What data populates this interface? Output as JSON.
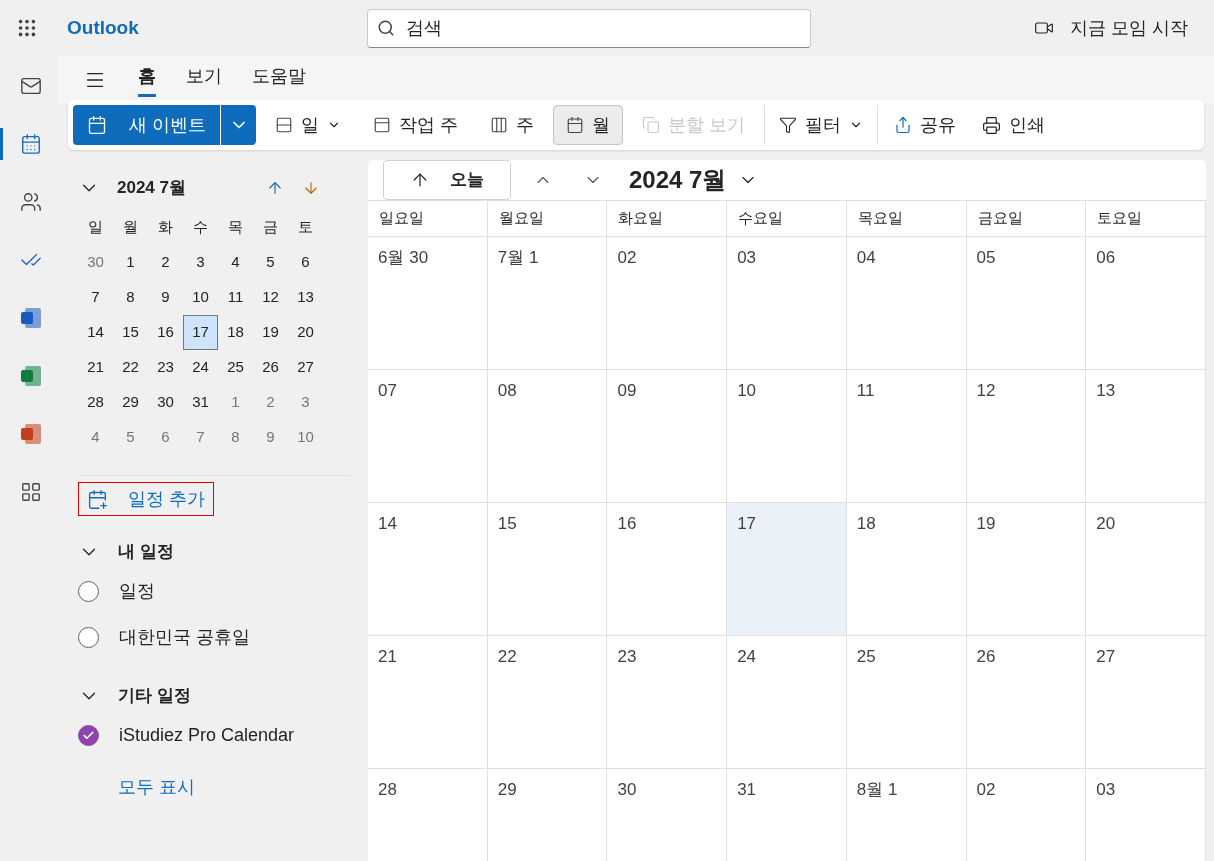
{
  "top_bar": {
    "brand": "Outlook",
    "search": {
      "placeholder": "검색"
    },
    "meet_now": "지금 모임 시작"
  },
  "rail": [
    {
      "kind": "mail",
      "selected": false
    },
    {
      "kind": "calendar",
      "selected": true
    },
    {
      "kind": "people",
      "selected": false
    },
    {
      "kind": "todo",
      "selected": false
    },
    {
      "kind": "word",
      "selected": false
    },
    {
      "kind": "excel",
      "selected": false
    },
    {
      "kind": "powerpoint",
      "selected": false
    },
    {
      "kind": "apps",
      "selected": false
    }
  ],
  "tabs": [
    {
      "label": "홈",
      "selected": true
    },
    {
      "label": "보기",
      "selected": false
    },
    {
      "label": "도움말",
      "selected": false
    }
  ],
  "toolbar": {
    "new_event": "새 이벤트",
    "views": [
      {
        "kind": "day",
        "label": "일",
        "selected": false,
        "disabled": false,
        "dropdown": true
      },
      {
        "kind": "workweek",
        "label": "작업 주",
        "selected": false,
        "disabled": false,
        "dropdown": false
      },
      {
        "kind": "week",
        "label": "주",
        "selected": false,
        "disabled": false,
        "dropdown": false
      },
      {
        "kind": "month",
        "label": "월",
        "selected": true,
        "disabled": false,
        "dropdown": false
      },
      {
        "kind": "split",
        "label": "분할 보기",
        "selected": false,
        "disabled": true,
        "dropdown": false
      }
    ],
    "filter": "필터",
    "share": "공유",
    "print": "인쇄"
  },
  "mini_calendar": {
    "title": "2024 7월",
    "weekdays": [
      "일",
      "월",
      "화",
      "수",
      "목",
      "금",
      "토"
    ],
    "weeks": [
      [
        {
          "day": "30",
          "outside": true,
          "selected": false
        },
        {
          "day": "1",
          "outside": false,
          "selected": false
        },
        {
          "day": "2",
          "outside": false,
          "selected": false
        },
        {
          "day": "3",
          "outside": false,
          "selected": false
        },
        {
          "day": "4",
          "outside": false,
          "selected": false
        },
        {
          "day": "5",
          "outside": false,
          "selected": false
        },
        {
          "day": "6",
          "outside": false,
          "selected": false
        }
      ],
      [
        {
          "day": "7",
          "outside": false,
          "selected": false
        },
        {
          "day": "8",
          "outside": false,
          "selected": false
        },
        {
          "day": "9",
          "outside": false,
          "selected": false
        },
        {
          "day": "10",
          "outside": false,
          "selected": false
        },
        {
          "day": "11",
          "outside": false,
          "selected": false
        },
        {
          "day": "12",
          "outside": false,
          "selected": false
        },
        {
          "day": "13",
          "outside": false,
          "selected": false
        }
      ],
      [
        {
          "day": "14",
          "outside": false,
          "selected": false
        },
        {
          "day": "15",
          "outside": false,
          "selected": false
        },
        {
          "day": "16",
          "outside": false,
          "selected": false
        },
        {
          "day": "17",
          "outside": false,
          "selected": true
        },
        {
          "day": "18",
          "outside": false,
          "selected": false
        },
        {
          "day": "19",
          "outside": false,
          "selected": false
        },
        {
          "day": "20",
          "outside": false,
          "selected": false
        }
      ],
      [
        {
          "day": "21",
          "outside": false,
          "selected": false
        },
        {
          "day": "22",
          "outside": false,
          "selected": false
        },
        {
          "day": "23",
          "outside": false,
          "selected": false
        },
        {
          "day": "24",
          "outside": false,
          "selected": false
        },
        {
          "day": "25",
          "outside": false,
          "selected": false
        },
        {
          "day": "26",
          "outside": false,
          "selected": false
        },
        {
          "day": "27",
          "outside": false,
          "selected": false
        }
      ],
      [
        {
          "day": "28",
          "outside": false,
          "selected": false
        },
        {
          "day": "29",
          "outside": false,
          "selected": false
        },
        {
          "day": "30",
          "outside": false,
          "selected": false
        },
        {
          "day": "31",
          "outside": false,
          "selected": false
        },
        {
          "day": "1",
          "outside": true,
          "selected": false
        },
        {
          "day": "2",
          "outside": true,
          "selected": false
        },
        {
          "day": "3",
          "outside": true,
          "selected": false
        }
      ],
      [
        {
          "day": "4",
          "outside": true,
          "selected": false
        },
        {
          "day": "5",
          "outside": true,
          "selected": false
        },
        {
          "day": "6",
          "outside": true,
          "selected": false
        },
        {
          "day": "7",
          "outside": true,
          "selected": false
        },
        {
          "day": "8",
          "outside": true,
          "selected": false
        },
        {
          "day": "9",
          "outside": true,
          "selected": false
        },
        {
          "day": "10",
          "outside": true,
          "selected": false
        }
      ]
    ]
  },
  "add_calendar": {
    "label": "일정 추가",
    "outlined": true
  },
  "calendar_groups": [
    {
      "title": "내 일정",
      "expanded": true,
      "calendars": [
        {
          "name": "일정",
          "checked": false
        },
        {
          "name": "대한민국 공휴일",
          "checked": false
        }
      ]
    },
    {
      "title": "기타 일정",
      "expanded": true,
      "calendars": [
        {
          "name": "iStudiez Pro Calendar",
          "checked": true,
          "color": "#8e44ad"
        }
      ]
    }
  ],
  "show_all": "모두 표시",
  "month_view": {
    "today_button": "오늘",
    "title": "2024 7월",
    "columns": [
      "일요일",
      "월요일",
      "화요일",
      "수요일",
      "목요일",
      "금요일",
      "토요일"
    ],
    "weeks": [
      [
        {
          "label": "6월 30",
          "today": false
        },
        {
          "label": "7월 1",
          "today": false
        },
        {
          "label": "02",
          "today": false
        },
        {
          "label": "03",
          "today": false
        },
        {
          "label": "04",
          "today": false
        },
        {
          "label": "05",
          "today": false
        },
        {
          "label": "06",
          "today": false
        }
      ],
      [
        {
          "label": "07",
          "today": false
        },
        {
          "label": "08",
          "today": false
        },
        {
          "label": "09",
          "today": false
        },
        {
          "label": "10",
          "today": false
        },
        {
          "label": "11",
          "today": false
        },
        {
          "label": "12",
          "today": false
        },
        {
          "label": "13",
          "today": false
        }
      ],
      [
        {
          "label": "14",
          "today": false
        },
        {
          "label": "15",
          "today": false
        },
        {
          "label": "16",
          "today": false
        },
        {
          "label": "17",
          "today": true
        },
        {
          "label": "18",
          "today": false
        },
        {
          "label": "19",
          "today": false
        },
        {
          "label": "20",
          "today": false
        }
      ],
      [
        {
          "label": "21",
          "today": false
        },
        {
          "label": "22",
          "today": false
        },
        {
          "label": "23",
          "today": false
        },
        {
          "label": "24",
          "today": false
        },
        {
          "label": "25",
          "today": false
        },
        {
          "label": "26",
          "today": false
        },
        {
          "label": "27",
          "today": false
        }
      ],
      [
        {
          "label": "28",
          "today": false
        },
        {
          "label": "29",
          "today": false
        },
        {
          "label": "30",
          "today": false
        },
        {
          "label": "31",
          "today": false
        },
        {
          "label": "8월 1",
          "today": false
        },
        {
          "label": "02",
          "today": false
        },
        {
          "label": "03",
          "today": false
        }
      ]
    ]
  }
}
